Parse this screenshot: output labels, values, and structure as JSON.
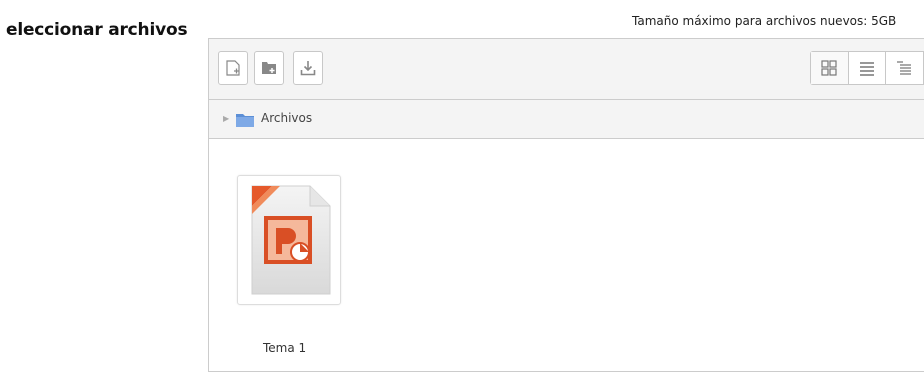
{
  "form": {
    "label": "eleccionar archivos",
    "max_size_text": "Tamaño máximo para archivos nuevos: 5GB"
  },
  "toolbar": {
    "buttons": [
      {
        "icon": "file-add-icon"
      },
      {
        "icon": "folder-create-icon"
      },
      {
        "icon": "download-icon"
      }
    ],
    "views": [
      {
        "icon": "grid-view-icon",
        "active": true
      },
      {
        "icon": "list-view-icon",
        "active": false
      },
      {
        "icon": "tree-view-icon",
        "active": false
      }
    ]
  },
  "path": {
    "current": "Archivos"
  },
  "files": [
    {
      "name": "Tema 1",
      "icon": "powerpoint-file-icon",
      "accent": "#e5592b"
    }
  ],
  "colors": {
    "border": "#cccccc",
    "toolbar_bg": "#f4f4f4",
    "folder": "#5c8fd6",
    "ppt_orange": "#e5592b"
  }
}
